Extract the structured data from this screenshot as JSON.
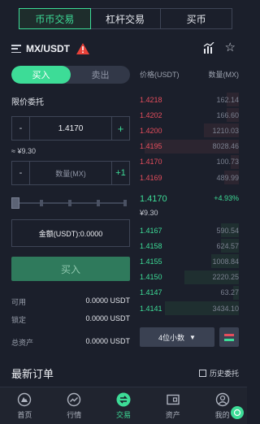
{
  "tabs": [
    {
      "label": "币币交易",
      "active": true
    },
    {
      "label": "杠杆交易",
      "active": false
    },
    {
      "label": "买币",
      "active": false
    }
  ],
  "pair": {
    "name": "MX/USDT"
  },
  "trade": {
    "buy_label": "买入",
    "sell_label": "卖出",
    "order_type": "限价委托",
    "price_value": "1.4170",
    "approx_cny": "≈ ¥9.30",
    "qty_placeholder": "数量(MX)",
    "minus": "-",
    "plus": "+",
    "plus_one": "+1",
    "amount": "金额(USDT):0.0000",
    "submit_label": "买入",
    "slider_fraction": 0
  },
  "balances": [
    {
      "label": "可用",
      "value": "0.0000 USDT"
    },
    {
      "label": "锁定",
      "value": "0.0000 USDT"
    },
    {
      "label": "总资产",
      "value": "0.0000 USDT"
    }
  ],
  "orderbook": {
    "price_header": "价格(USDT)",
    "qty_header": "数量(MX)",
    "asks": [
      {
        "price": "1.4218",
        "qty": "162.14",
        "depth": 0.12
      },
      {
        "price": "1.4202",
        "qty": "166.60",
        "depth": 0.12
      },
      {
        "price": "1.4200",
        "qty": "1210.03",
        "depth": 0.35
      },
      {
        "price": "1.4195",
        "qty": "8028.46",
        "depth": 0.95
      },
      {
        "price": "1.4170",
        "qty": "100.73",
        "depth": 0.08
      },
      {
        "price": "1.4169",
        "qty": "489.99",
        "depth": 0.15
      }
    ],
    "last_price": "1.4170",
    "change": "+4.93%",
    "last_cny": "¥9.30",
    "bids": [
      {
        "price": "1.4167",
        "qty": "590.54",
        "depth": 0.18
      },
      {
        "price": "1.4158",
        "qty": "624.57",
        "depth": 0.18
      },
      {
        "price": "1.4155",
        "qty": "1008.84",
        "depth": 0.28
      },
      {
        "price": "1.4150",
        "qty": "2220.25",
        "depth": 0.55
      },
      {
        "price": "1.4147",
        "qty": "63.27",
        "depth": 0.06
      },
      {
        "price": "1.4141",
        "qty": "3434.10",
        "depth": 0.75
      }
    ],
    "depth_select": "4位小数"
  },
  "recent": {
    "title": "最新订单",
    "history_label": "历史委托"
  },
  "nav": [
    {
      "label": "首页",
      "icon": "home-icon",
      "active": false
    },
    {
      "label": "行情",
      "icon": "market-icon",
      "active": false
    },
    {
      "label": "交易",
      "icon": "trade-icon",
      "active": true
    },
    {
      "label": "资产",
      "icon": "wallet-icon",
      "active": false
    },
    {
      "label": "我的",
      "icon": "profile-icon",
      "active": false
    }
  ],
  "colors": {
    "background": "#1b1f2b",
    "accent_green": "#3ddc97",
    "ask_red": "#e44d5c",
    "buy_button": "#2f7a5c"
  }
}
